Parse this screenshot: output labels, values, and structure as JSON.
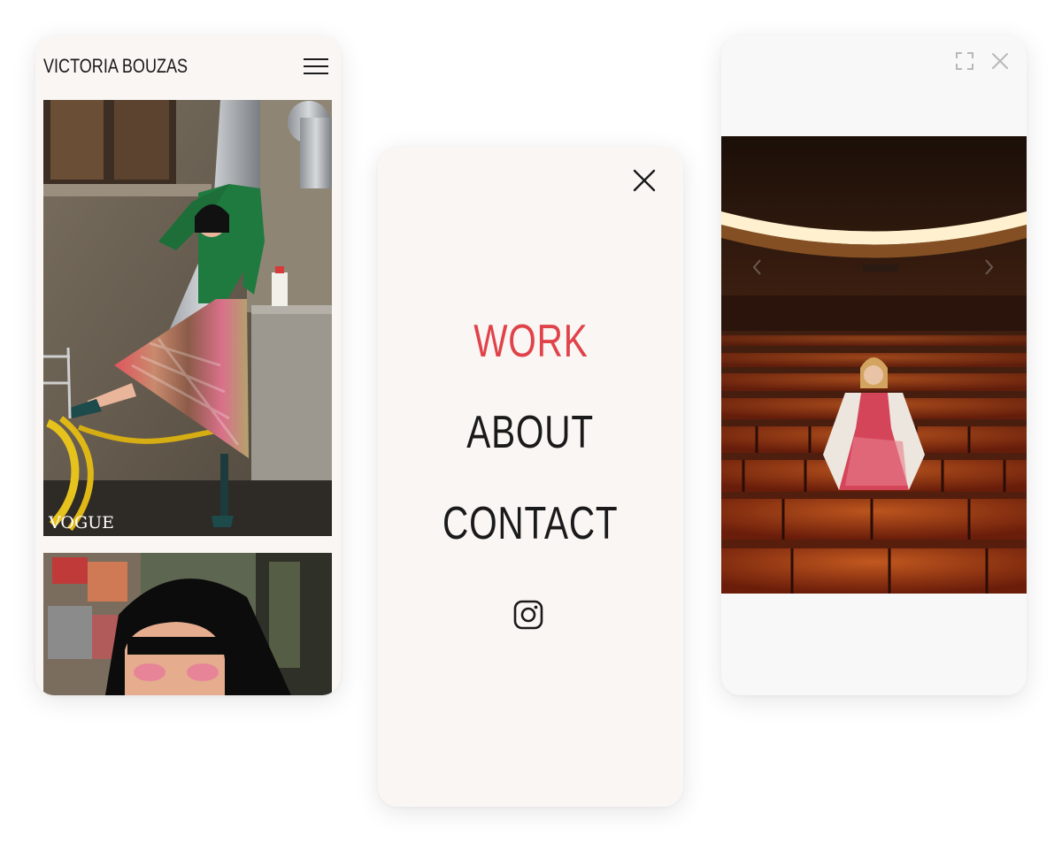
{
  "phone_portfolio": {
    "brand_name": "VICTORIA BOUZAS",
    "menu_icon": "hamburger-icon",
    "photos": [
      {
        "caption_overlay": "VOGUE"
      },
      {
        "caption_overlay": ""
      }
    ]
  },
  "phone_menu": {
    "close_icon": "close-icon",
    "items": [
      {
        "label": "WORK",
        "active": true
      },
      {
        "label": "ABOUT",
        "active": false
      },
      {
        "label": "CONTACT",
        "active": false
      }
    ],
    "social_icon": "instagram-icon"
  },
  "phone_lightbox": {
    "icons": [
      "fullscreen-icon",
      "close-icon",
      "chevron-left-icon",
      "chevron-right-icon"
    ]
  },
  "colors": {
    "background": "#faf6f4",
    "accent": "#e0434a",
    "text": "#1a1a1a"
  }
}
